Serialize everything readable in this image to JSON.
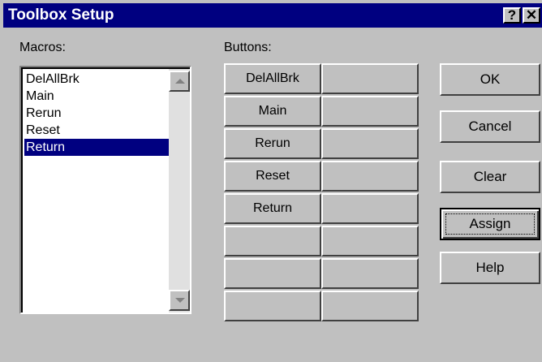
{
  "window": {
    "title": "Toolbox Setup"
  },
  "titlebar_buttons": {
    "help": "?",
    "close": "✕"
  },
  "macros": {
    "label": "Macros:",
    "items": [
      "DelAllBrk",
      "Main",
      "Rerun",
      "Reset",
      "Return"
    ],
    "selected": "Return"
  },
  "buttons": {
    "label": "Buttons:",
    "grid": [
      [
        "DelAllBrk",
        ""
      ],
      [
        "Main",
        ""
      ],
      [
        "Rerun",
        ""
      ],
      [
        "Reset",
        ""
      ],
      [
        "Return",
        ""
      ],
      [
        "",
        ""
      ],
      [
        "",
        ""
      ],
      [
        "",
        ""
      ]
    ]
  },
  "actions": {
    "ok": "OK",
    "cancel": "Cancel",
    "clear": "Clear",
    "assign": "Assign",
    "help": "Help"
  },
  "colors": {
    "titlebar": "#000080",
    "selection": "#000080",
    "face": "#c0c0c0"
  }
}
